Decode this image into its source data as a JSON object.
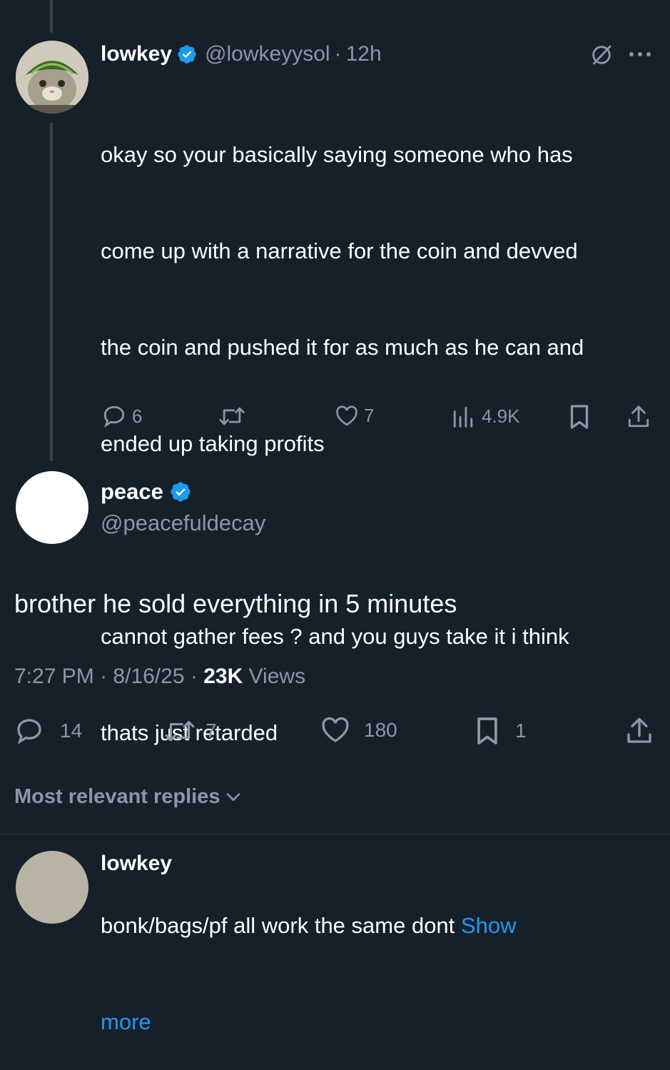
{
  "colors": {
    "background": "#15202b",
    "text": "#ffffff",
    "muted": "#8b98a5",
    "link": "#1d9bf0",
    "verified": "#1d9bf0"
  },
  "reply": {
    "name": "lowkey",
    "handle": "@lowkeyysol",
    "time": "12h",
    "separator": "·",
    "body_p1_line1": "okay so your basically saying someone who has",
    "body_p1_line2": "come up with a narrative for the coin and devved",
    "body_p1_line3": "the coin and pushed it for as much as he can and",
    "body_p1_line4": "ended up taking profits",
    "body_p2_line1": "cannot gather fees ? and you guys take it i think",
    "body_p2_line2": "thats just retarded",
    "body_p3_line1": "bonk/bags/pf all work the same dont",
    "show_more_1": "Show",
    "show_more_2": "more",
    "replies": "6",
    "likes": "7",
    "views": "4.9K",
    "icons": [
      "grok-icon",
      "more-icon",
      "reply-icon",
      "retweet-icon",
      "like-icon",
      "views-icon",
      "bookmark-icon",
      "share-icon"
    ]
  },
  "main": {
    "name": "peace",
    "handle": "@peacefuldecay",
    "body": "brother he sold everything in 5 minutes",
    "time": "7:27 PM",
    "date": "8/16/25",
    "sep": "·",
    "views_count": "23K",
    "views_label": "Views",
    "replies": "14",
    "retweets": "7",
    "likes": "180",
    "bookmarks": "1"
  },
  "sort": {
    "label": "Most relevant replies"
  },
  "next_reply": {
    "name": "lowkey"
  }
}
